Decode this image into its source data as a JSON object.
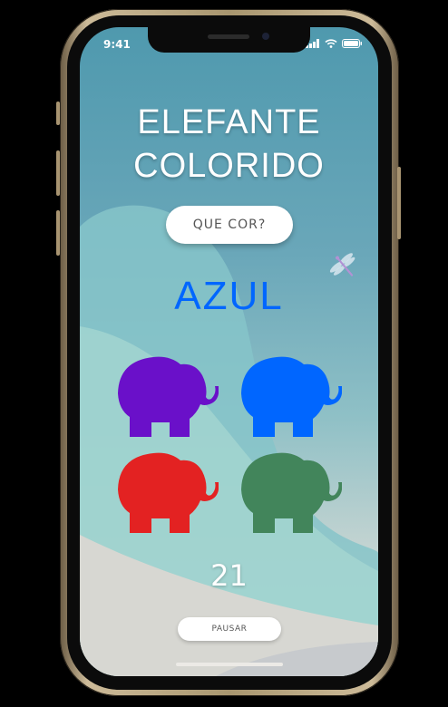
{
  "status_bar": {
    "time": "9:41"
  },
  "game": {
    "title_line1": "ELEFANTE",
    "title_line2": "COLORIDO",
    "question_label": "QUE COR?",
    "target_color_word": "AZUL",
    "target_color_hex": "#0066ff",
    "timer": "21",
    "pause_label": "PAUSAR"
  },
  "elephants": [
    {
      "color_name": "roxo",
      "hex": "#6a10c9"
    },
    {
      "color_name": "azul",
      "hex": "#0066ff"
    },
    {
      "color_name": "vermelho",
      "hex": "#e32222"
    },
    {
      "color_name": "verde",
      "hex": "#42855b"
    }
  ],
  "icons": {
    "decoration": "dragonfly-icon",
    "signal": "signal-icon",
    "wifi": "wifi-icon",
    "battery": "battery-icon"
  }
}
